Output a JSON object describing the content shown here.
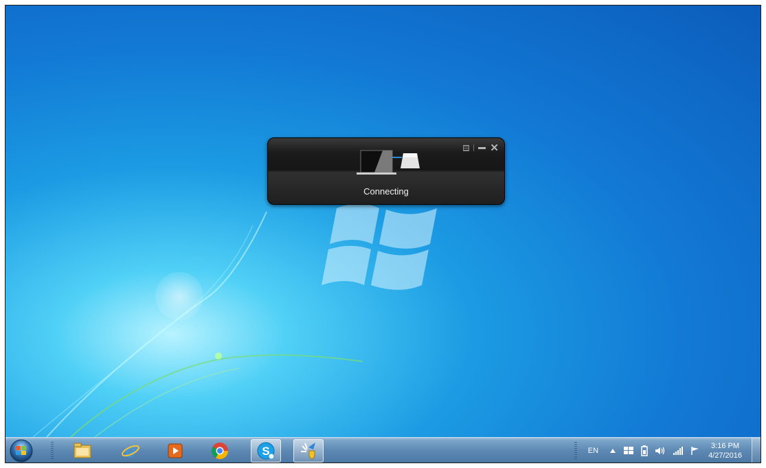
{
  "widget": {
    "status": "Connecting",
    "controls": {
      "menu_icon": "menu-icon",
      "minimize_icon": "minimize-icon",
      "close_icon": "close-icon"
    }
  },
  "taskbar": {
    "start_icon": "windows-start-icon",
    "pinned": [
      {
        "name": "file-explorer-icon",
        "active": false
      },
      {
        "name": "internet-explorer-icon",
        "active": false
      },
      {
        "name": "media-player-icon",
        "active": false
      },
      {
        "name": "chrome-icon",
        "active": false
      },
      {
        "name": "skype-icon",
        "active": true
      },
      {
        "name": "connection-app-icon",
        "active": true
      }
    ],
    "tray": {
      "language": "EN",
      "icons": [
        "show-hidden-icons-arrow-icon",
        "windows-flag-icon",
        "battery-icon",
        "volume-icon",
        "network-signal-icon",
        "action-center-flag-icon"
      ]
    },
    "clock": {
      "time": "3:16 PM",
      "date": "4/27/2016"
    }
  },
  "colors": {
    "desktop_blue": "#1279d4",
    "widget_bg": "#1b1b1b",
    "taskbar_blue": "#5d88b3"
  }
}
